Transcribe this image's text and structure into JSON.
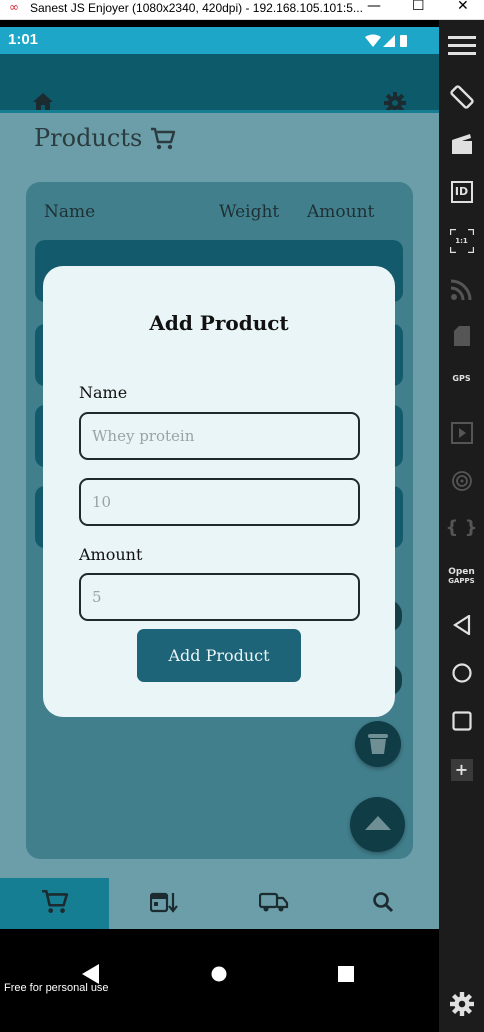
{
  "window": {
    "logo_glyph": "∞",
    "title": "Sanest JS Enjoyer (1080x2340, 420dpi) - 192.168.105.101:5...",
    "minimize_glyph": "—",
    "maximize_glyph": "☐",
    "close_glyph": "✕"
  },
  "statusbar": {
    "time": "1:01"
  },
  "page": {
    "title": "Products",
    "columns": [
      "Name",
      "Weight",
      "Amount"
    ]
  },
  "modal": {
    "title": "Add Product",
    "name_label": "Name",
    "name_placeholder": "Whey protein",
    "weight_placeholder": "10",
    "amount_label": "Amount",
    "amount_placeholder": "5",
    "submit_label": "Add Product"
  },
  "bottom_nav": {
    "items": [
      {
        "icon": "cart-icon",
        "active": true
      },
      {
        "icon": "calendar-sort-icon",
        "active": false
      },
      {
        "icon": "truck-icon",
        "active": false
      },
      {
        "icon": "search-icon",
        "active": false
      }
    ]
  },
  "footer": {
    "personal_use": "Free for personal use"
  },
  "side_panel": {
    "gps_label": "GPS",
    "id_label": "ID",
    "ratio_label": "1:1",
    "braces_label": "{ }",
    "open_label": "Open",
    "gapps_label": "GAPPS",
    "plus_label": "+"
  },
  "colors": {
    "accent": "#1ea6c8",
    "appbar": "#0d5a6a",
    "button": "#1e6478",
    "modal_bg": "#eaf5f7"
  }
}
